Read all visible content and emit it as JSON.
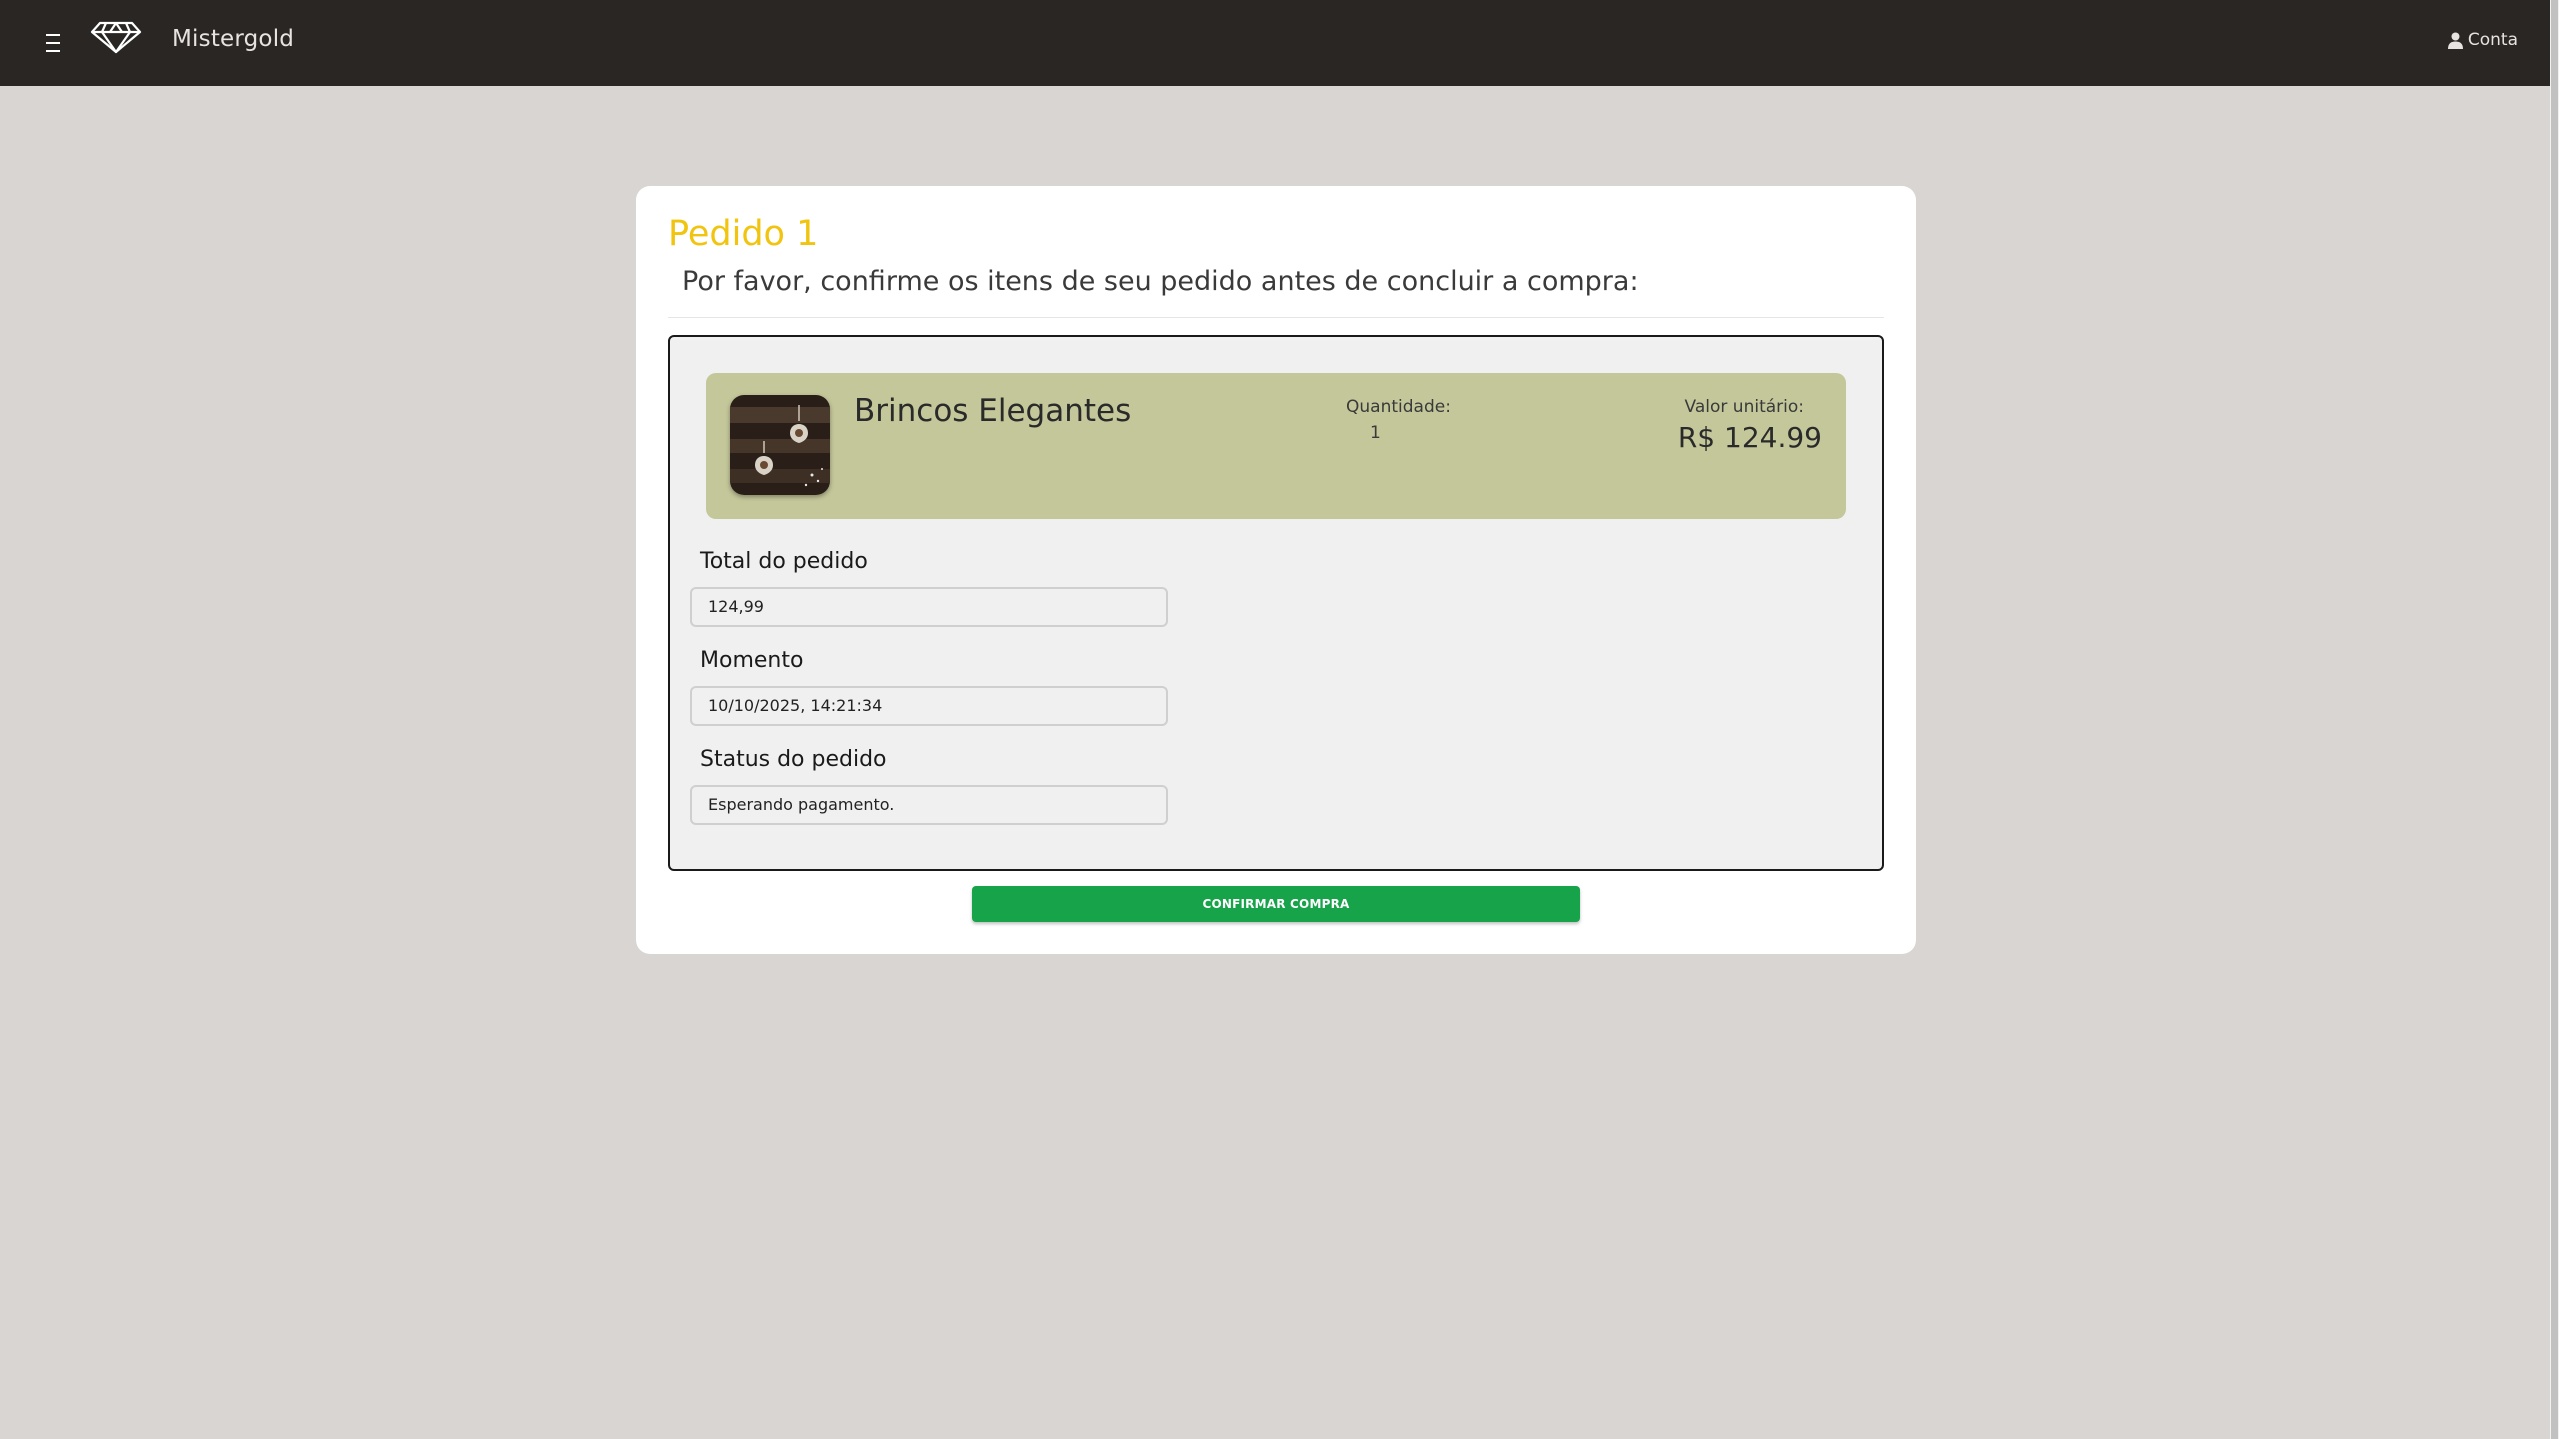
{
  "navbar": {
    "menu_icon": "hamburger-menu-icon",
    "logo_icon": "diamond-logo-icon",
    "brand": "Mistergold",
    "account_icon": "user-icon",
    "account_label": "Conta"
  },
  "order": {
    "title": "Pedido 1",
    "subtitle": "Por favor, confirme os itens de seu pedido antes de concluir a compra:",
    "items": [
      {
        "name": "Brincos Elegantes",
        "image_icon": "earrings-product-image",
        "quantity_label": "Quantidade:",
        "quantity": "1",
        "unit_price_label": "Valor unitário:",
        "unit_price": "R$ 124.99"
      }
    ],
    "fields": {
      "total": {
        "label": "Total do pedido",
        "value": "124,99"
      },
      "moment": {
        "label": "Momento",
        "value": "10/10/2025, 14:21:34"
      },
      "status": {
        "label": "Status do pedido",
        "value": "Esperando pagamento."
      }
    },
    "confirm_button": "CONFIRMAR COMPRA"
  },
  "colors": {
    "navbar_bg": "#292624",
    "page_bg": "#d8d5d2",
    "title_accent": "#f1c40f",
    "item_bg": "#c4c79a",
    "button_bg": "#16a34a"
  }
}
